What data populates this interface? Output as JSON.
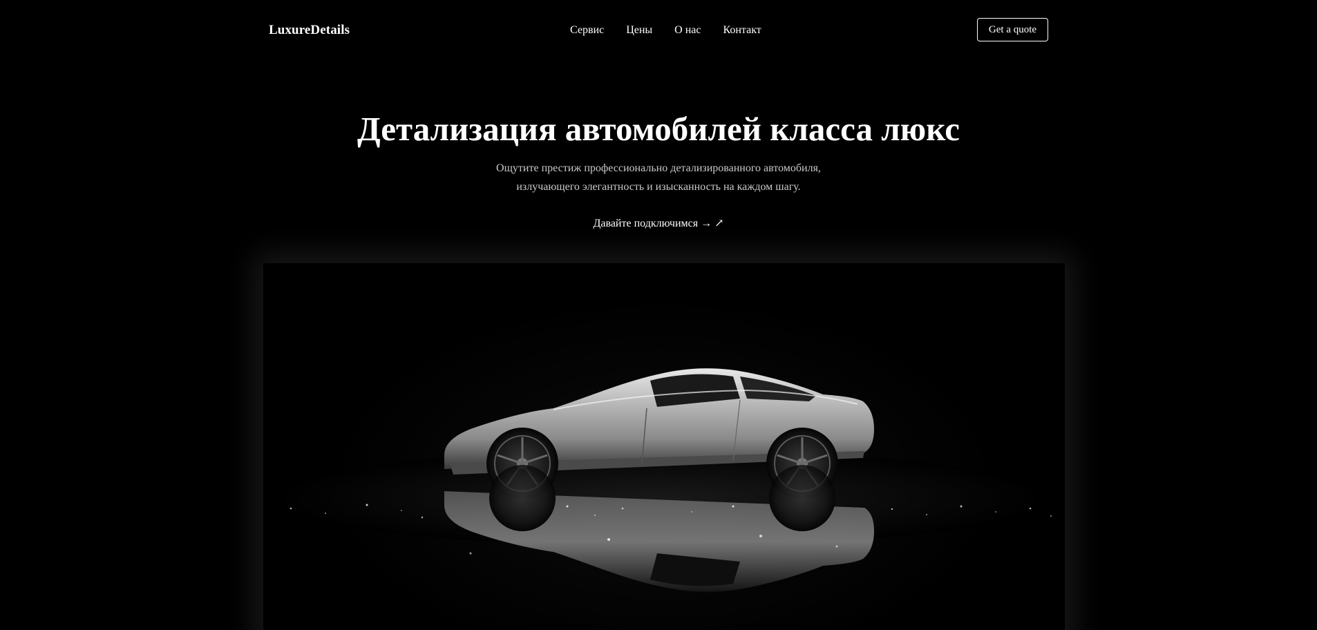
{
  "header": {
    "brand": "LuxureDetails",
    "nav": [
      {
        "label": "Сервис"
      },
      {
        "label": "Цены"
      },
      {
        "label": "О нас"
      },
      {
        "label": "Контакт"
      }
    ],
    "quote_button": "Get a quote"
  },
  "hero": {
    "title": "Детализация автомобилей класса люкс",
    "subtitle_line1": "Ощутите престиж профессионально детализированного автомобиля,",
    "subtitle_line2": "излучающего элегантность и изысканность на каждом шагу.",
    "cta": "Давайте подключимся → ↗"
  },
  "image": {
    "subject": "silver-sports-car"
  },
  "colors": {
    "background": "#000000",
    "text": "#ffffff",
    "subtitle": "#c9c9c9"
  }
}
